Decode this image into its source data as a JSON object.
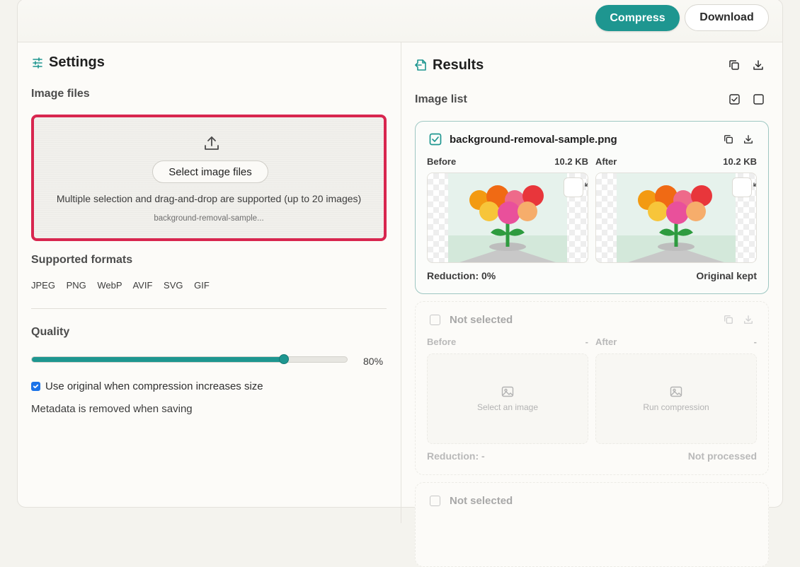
{
  "toolbar": {
    "compress_label": "Compress",
    "download_label": "Download"
  },
  "settings": {
    "title": "Settings",
    "image_files_label": "Image files",
    "select_button": "Select image files",
    "help_text": "Multiple selection and drag-and-drop are supported (up to 20 images)",
    "selected_file": "background-removal-sample...",
    "formats_label": "Supported formats",
    "formats": [
      "JPEG",
      "PNG",
      "WebP",
      "AVIF",
      "SVG",
      "GIF"
    ],
    "quality_label": "Quality",
    "quality_value": 80,
    "quality_text": "80%",
    "use_original_label": "Use original when compression increases size",
    "use_original_checked": true,
    "metadata_note": "Metadata is removed when saving"
  },
  "results": {
    "title": "Results",
    "image_list_label": "Image list",
    "cards": [
      {
        "title": "background-removal-sample.png",
        "selected": true,
        "before_label": "Before",
        "before_size": "10.2 KB",
        "after_label": "After",
        "after_size": "10.2 KB",
        "reduction": "Reduction: 0%",
        "status": "Original kept"
      },
      {
        "title": "Not selected",
        "selected": false,
        "before_label": "Before",
        "before_size": "-",
        "after_label": "After",
        "after_size": "-",
        "before_placeholder": "Select an image",
        "after_placeholder": "Run compression",
        "reduction": "Reduction: -",
        "status": "Not processed"
      },
      {
        "title": "Not selected",
        "selected": false
      }
    ]
  },
  "colors": {
    "accent": "#1e9690",
    "highlight_border": "#d8264f",
    "checkbox_blue": "#1a73e8"
  },
  "icons": [
    "sliders-icon",
    "upload-icon",
    "file-export-icon",
    "copy-icon",
    "download-icon",
    "check-square-icon",
    "square-icon",
    "expand-icon",
    "image-icon"
  ]
}
